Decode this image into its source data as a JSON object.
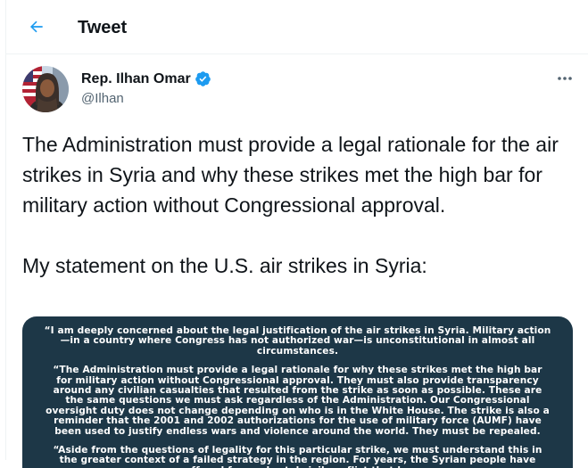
{
  "header": {
    "back_icon": "arrow-left-icon",
    "title": "Tweet"
  },
  "author": {
    "name": "Rep. Ilhan Omar",
    "handle": "@Ilhan",
    "verified": true,
    "verified_icon": "verified-badge-icon"
  },
  "more_icon": "ellipsis-icon",
  "tweet": {
    "text": "The Administration must provide a legal rationale for the air strikes in Syria and why these strikes met the high bar for military action without Congressional approval.\n\nMy statement on the U.S. air strikes in Syria:"
  },
  "media": {
    "quote1": "“I am deeply concerned about the legal justification of the air strikes in Syria. Military action—in a country where Congress has not authorized war—is unconstitutional in almost all circumstances.",
    "quote2": "“The Administration must provide a legal rationale for why these strikes met the high bar for military action without Congressional approval. They must also provide transparency around any civilian casualties that resulted from the strike as soon as possible. These are the same questions we must ask regardless of the Administration. Our Congressional oversight duty does not change depending on who is in the White House. The strike is also a reminder that the 2001 and 2002 authorizations for the use of military force (AUMF) have been used to justify endless wars and violence around the world. They must be repealed.",
    "quote3": "“Aside from the questions of legality for this particular strike, we must understand this in the greater context of a failed strategy in the region. For years, the Syrian people have suffered from a brutal civil conflict that has"
  },
  "colors": {
    "accent": "#1d9bf0",
    "media_background": "#1d3747",
    "secondary_text": "#536471"
  }
}
